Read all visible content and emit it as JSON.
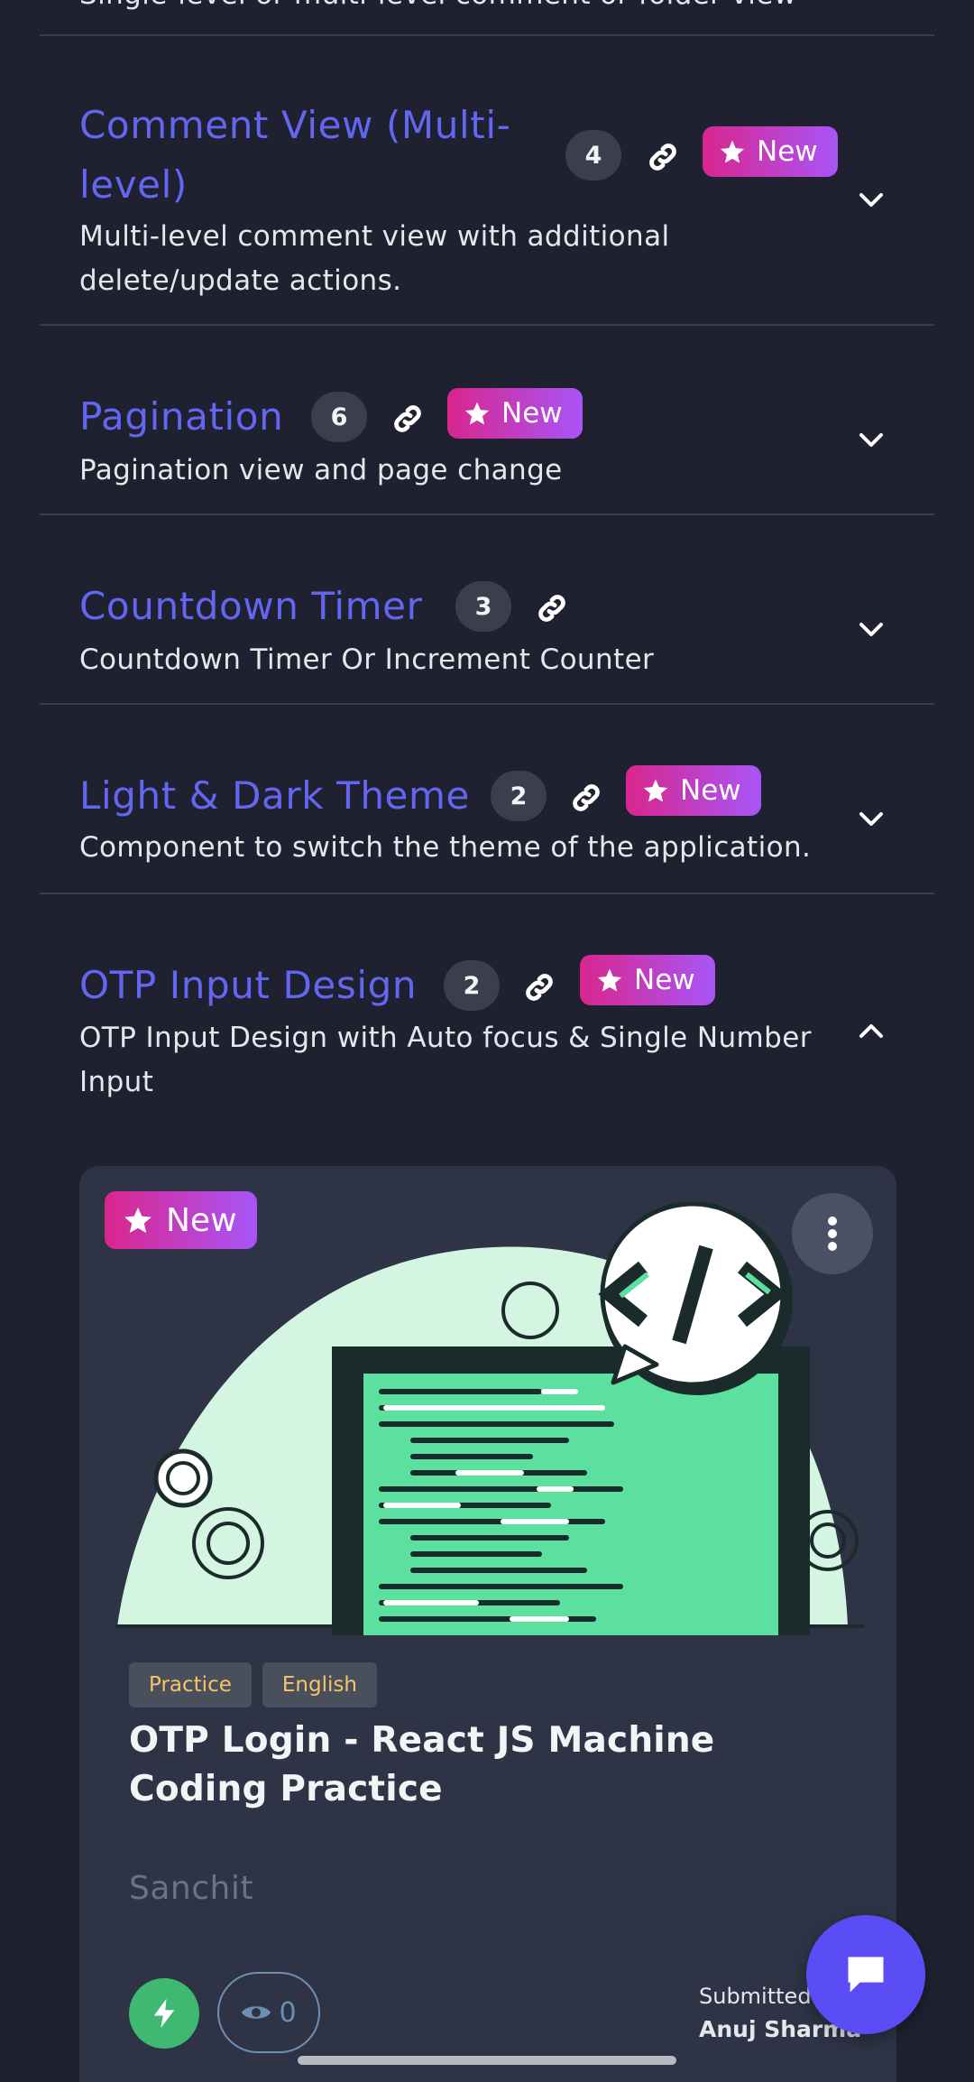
{
  "colors": {
    "accent": "#6366f1",
    "background": "#1f2130",
    "card": "#2e3446",
    "new_gradient_start": "#d9268d",
    "new_gradient_end": "#a855f7",
    "tag_text": "#f5c46b",
    "chat_fab": "#5b4df5",
    "bolt": "#3fb872"
  },
  "truncated_top_text": "Single-level or multi-level comment or folder view",
  "new_label": "New",
  "items": [
    {
      "title": "Comment View (Multi-level)",
      "count": "4",
      "is_new": true,
      "description_line1": "Multi-level comment view with additional",
      "description_line2": "delete/update actions.",
      "expanded": false
    },
    {
      "title": "Pagination",
      "count": "6",
      "is_new": true,
      "description_line1": "Pagination view and page change",
      "expanded": false
    },
    {
      "title": "Countdown Timer",
      "count": "3",
      "is_new": false,
      "description_line1": "Countdown Timer Or Increment Counter",
      "expanded": false
    },
    {
      "title": "Light & Dark Theme",
      "count": "2",
      "is_new": true,
      "description_line1": "Component to switch the theme of the application.",
      "expanded": false
    },
    {
      "title": "OTP Input Design",
      "count": "2",
      "is_new": true,
      "description_line1": "OTP Input Design with Auto focus & Single Number",
      "description_line2": "Input",
      "expanded": true
    }
  ],
  "card": {
    "new_label": "New",
    "tags": [
      "Practice",
      "English"
    ],
    "title": "OTP Login - React JS Machine Coding Practice",
    "author": "Sanchit",
    "views": "0",
    "submitted_label": "Submitted",
    "submitted_by": "Anuj Sharma"
  },
  "icons": {
    "link": "link-icon",
    "chevron_down": "chevron-down-icon",
    "chevron_up": "chevron-up-icon",
    "star": "star-icon",
    "kebab": "kebab-icon",
    "bolt": "bolt-icon",
    "eye": "eye-icon",
    "chat": "chat-icon"
  }
}
